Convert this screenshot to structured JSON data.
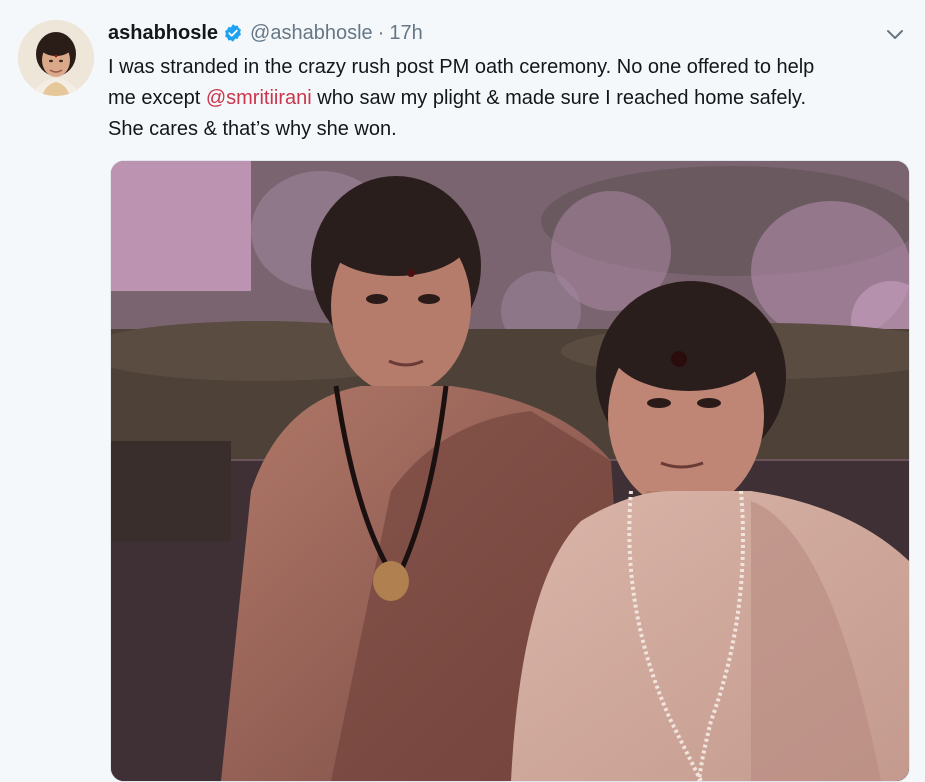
{
  "tweet": {
    "display_name": "ashabhosle",
    "handle": "@ashabhosle",
    "separator": "·",
    "time": "17h",
    "text_line1": "I was stranded in the crazy rush post PM oath ceremony. No one offered to help",
    "text_line2_before": "me except ",
    "mention": "@smritiirani",
    "text_line2_after": " who saw my plight & made sure I reached home safely.",
    "text_line3": "She cares & that’s why she won."
  },
  "icons": {
    "verified": "verified-badge-icon",
    "caret": "chevron-down-icon"
  },
  "colors": {
    "verified_blue": "#1da1f2",
    "mention": "#c9364b",
    "secondary_text": "#657786"
  }
}
